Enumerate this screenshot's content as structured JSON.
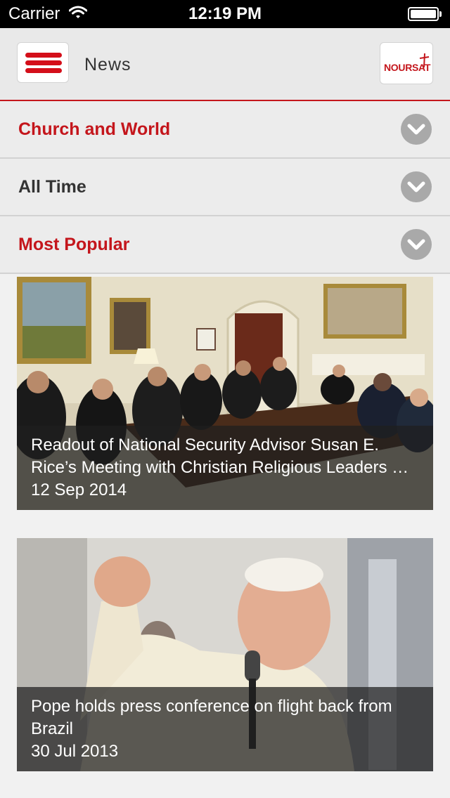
{
  "status_bar": {
    "carrier": "Carrier",
    "time": "12:19 PM"
  },
  "nav": {
    "title": "News",
    "logo_text": "NOURSAT",
    "accent_color": "#c4161c"
  },
  "filters": [
    {
      "label": "Church and World",
      "color": "#c4161c"
    },
    {
      "label": "All Time",
      "color": "#333333"
    },
    {
      "label": "Most Popular",
      "color": "#c4161c"
    }
  ],
  "articles": [
    {
      "title": "Readout of National Security Advisor Susan E. Rice’s Meeting with Christian Religious Leaders …",
      "date": "12 Sep 2014"
    },
    {
      "title": "Pope holds press conference on flight back from Brazil",
      "date": "30 Jul 2013"
    }
  ],
  "icons": {
    "wifi": "wifi-icon",
    "battery": "battery-icon",
    "menu": "hamburger-menu-icon",
    "chevron": "chevron-down-icon",
    "logo_mark": "cross-icon"
  }
}
